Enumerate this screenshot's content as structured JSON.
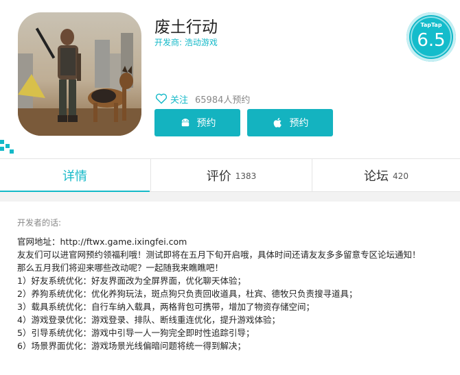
{
  "app": {
    "title": "废土行动",
    "developer_label": "开发商:",
    "developer_name": "浩动游戏"
  },
  "rating": {
    "brand": "TapTap",
    "score": "6.5"
  },
  "follow": {
    "label": "关注",
    "count_text": "65984人预约"
  },
  "buttons": {
    "android_label": "预约",
    "ios_label": "预约"
  },
  "tabs": [
    {
      "label": "详情",
      "count": ""
    },
    {
      "label": "评价",
      "count": "1383"
    },
    {
      "label": "论坛",
      "count": "420"
    }
  ],
  "content": {
    "heading": "开发者的话:",
    "lines": [
      "官网地址：http://ftwx.game.ixingfei.com",
      "友友们可以进官网预约领福利哦！测试即将在五月下旬开启哦，具体时间还请友友多多留意专区论坛通知！",
      "那么五月我们将迎来哪些改动呢？一起随我来瞧瞧吧！",
      "1）好友系统优化：好友界面改为全屏界面，优化聊天体验；",
      "2）养狗系统优化：优化养狗玩法，斑点狗只负责回收道具，杜宾、德牧只负责搜寻道具；",
      "3）载具系统优化：自行车纳入载具，两格背包可携带，增加了物资存储空间；",
      "4）游戏登录优化：游戏登录、排队、断线重连优化，提升游戏体验；",
      "5）引导系统优化：游戏中引导一人一狗完全即时性追踪引导；",
      "6）场景界面优化：游戏场景光线偏暗问题将统一得到解决；"
    ]
  },
  "colors": {
    "accent": "#14b9c8",
    "button": "#14b3c0"
  }
}
